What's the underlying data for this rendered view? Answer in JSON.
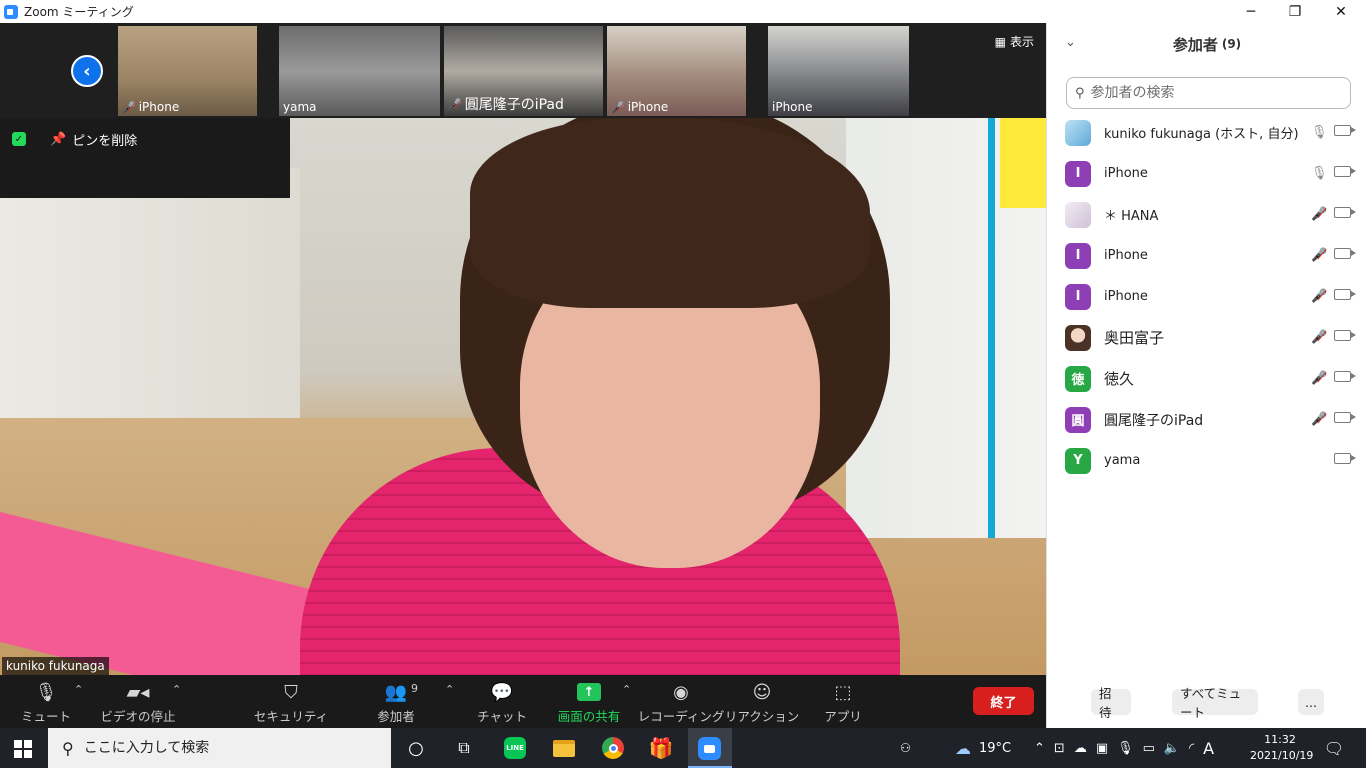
{
  "window": {
    "title": "Zoom ミーティング",
    "minimize": "─",
    "maximize": "❐",
    "close": "✕"
  },
  "strip": {
    "show_label": "表示",
    "thumbnails": [
      {
        "name": "iPhone",
        "muted": true,
        "color": "#8a7a63"
      },
      {
        "name": "yama",
        "muted": false,
        "color": "#6f6f6f"
      },
      {
        "name": "圓尾隆子のiPad",
        "muted": true,
        "color": "#8c8c8c"
      },
      {
        "name": "iPhone",
        "muted": true,
        "color": "#9a8a80"
      },
      {
        "name": "iPhone",
        "muted": false,
        "color": "#7f8187"
      }
    ]
  },
  "main_video": {
    "unpin_label": "ピンを削除",
    "speaker_name": "kuniko fukunaga"
  },
  "toolbar": {
    "mute": "ミュート",
    "stop_video": "ビデオの停止",
    "security": "セキュリティ",
    "participants": "参加者",
    "participants_count": "9",
    "chat": "チャット",
    "share_screen": "画面の共有",
    "recording": "レコーディング",
    "reactions": "リアクション",
    "apps": "アプリ",
    "end": "終了"
  },
  "panel": {
    "title": "参加者",
    "count": "(9)",
    "search_placeholder": "参加者の検索",
    "participants": [
      {
        "name": "kuniko fukunaga (ホスト, 自分)",
        "avatar": "",
        "avatar_color": "#8fc9e6",
        "mic": "on"
      },
      {
        "name": "iPhone",
        "avatar": "I",
        "avatar_color": "#8e3fb5",
        "mic": "on"
      },
      {
        "name": "＊ HANA",
        "avatar": "",
        "avatar_color": "#e8dfe9",
        "mic": "off"
      },
      {
        "name": "iPhone",
        "avatar": "I",
        "avatar_color": "#8e3fb5",
        "mic": "off"
      },
      {
        "name": "iPhone",
        "avatar": "I",
        "avatar_color": "#8e3fb5",
        "mic": "off"
      },
      {
        "name": "奥田富子",
        "avatar": "",
        "avatar_color": "#d9b9a3",
        "mic": "off"
      },
      {
        "name": "徳久",
        "avatar": "徳",
        "avatar_color": "#28a745",
        "mic": "off"
      },
      {
        "name": "圓尾隆子のiPad",
        "avatar": "圓",
        "avatar_color": "#8e3fb5",
        "mic": "off"
      },
      {
        "name": "yama",
        "avatar": "Y",
        "avatar_color": "#28a745",
        "mic": "none"
      }
    ],
    "invite": "招待",
    "mute_all": "すべてミュート",
    "more": "..."
  },
  "taskbar": {
    "search_placeholder": "ここに入力して検索",
    "weather": "19°C",
    "time": "11:32",
    "date": "2021/10/19",
    "ime": "A"
  }
}
